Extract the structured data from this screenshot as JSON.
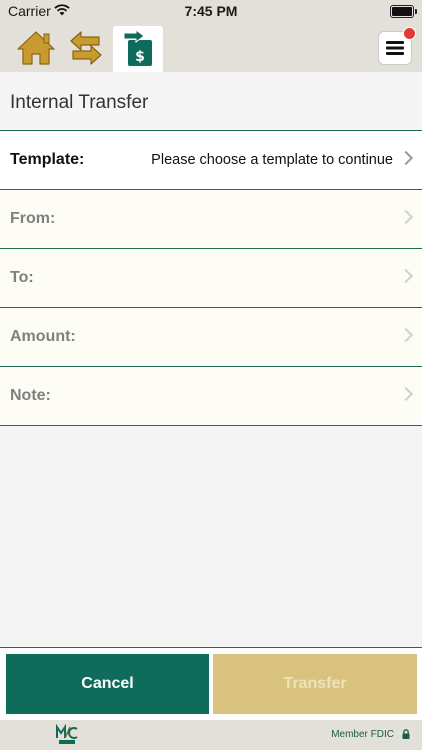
{
  "status_bar": {
    "carrier": "Carrier",
    "time": "7:45 PM"
  },
  "nav": {
    "home_icon": "home-icon",
    "swap_icon": "transfer-arrows-icon",
    "active_icon": "internal-transfer-icon",
    "menu_icon": "hamburger-menu-icon",
    "has_notification": true
  },
  "page": {
    "title": "Internal Transfer"
  },
  "form": {
    "template": {
      "label": "Template:",
      "value": "Please choose a template to continue"
    },
    "from": {
      "label": "From:",
      "value": ""
    },
    "to": {
      "label": "To:",
      "value": ""
    },
    "amount": {
      "label": "Amount:",
      "value": ""
    },
    "note": {
      "label": "Note:",
      "value": ""
    }
  },
  "actions": {
    "cancel_label": "Cancel",
    "transfer_label": "Transfer"
  },
  "footer": {
    "fdic": "Member FDIC"
  },
  "colors": {
    "primary_green": "#0f6b5a",
    "transfer_disabled": "#d9c27e",
    "gold_icon": "#c99a2e",
    "divider": "#1f6b57",
    "notification": "#e53935"
  }
}
